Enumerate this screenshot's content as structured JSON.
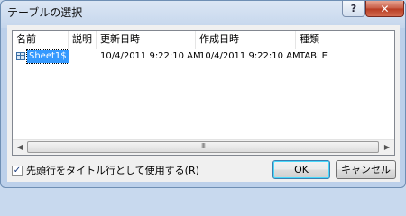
{
  "dialog": {
    "title": "テーブルの選択",
    "help_label": "?",
    "close_label": "✕"
  },
  "list": {
    "columns": [
      "名前",
      "説明",
      "更新日時",
      "作成日時",
      "種類"
    ],
    "rows": [
      {
        "name": "Sheet1$",
        "description": "",
        "modified": "10/4/2011 9:22:10 AM",
        "created": "10/4/2011 9:22:10 AM",
        "type": "TABLE"
      }
    ],
    "selected_row": 0
  },
  "scrollbar": {
    "left_arrow": "◀",
    "right_arrow": "▶",
    "grip": "III"
  },
  "option": {
    "checked": true,
    "check_mark": "✓",
    "label": "先頭行をタイトル行として使用する(R)"
  },
  "buttons": {
    "ok": "OK",
    "cancel": "キャンセル"
  }
}
